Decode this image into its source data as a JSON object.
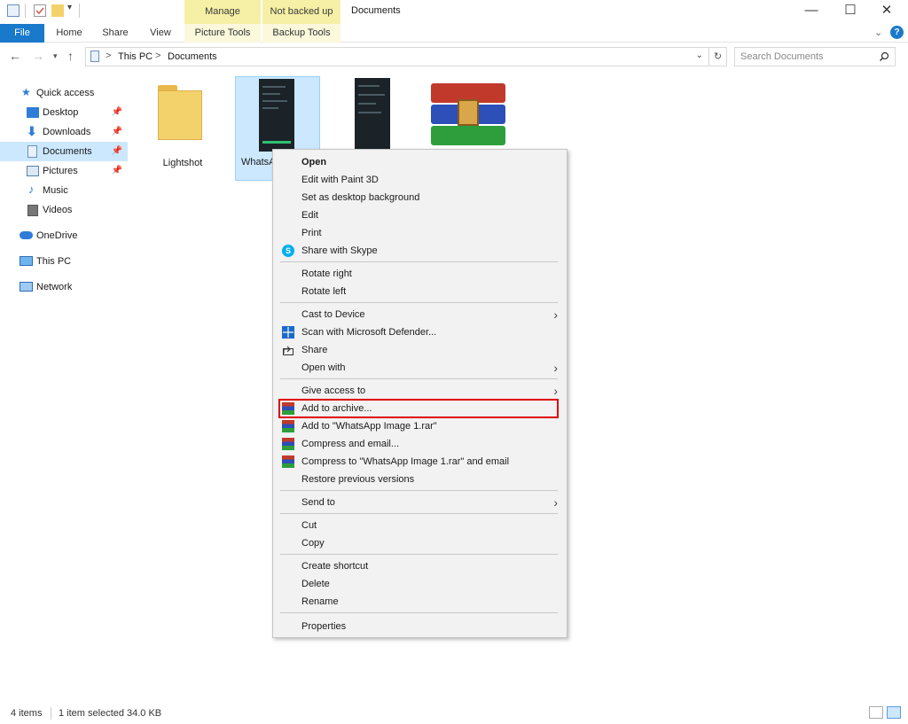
{
  "window": {
    "title": "Documents",
    "context_tab_manage": "Manage",
    "context_tab_backup": "Not backed up",
    "minimize": "—",
    "maximize": "☐",
    "close": "✕"
  },
  "ribbon": {
    "tabs": [
      "File",
      "Home",
      "Share",
      "View",
      "Picture Tools",
      "Backup Tools"
    ],
    "help": "?"
  },
  "address": {
    "crumbs": [
      "This PC",
      "Documents"
    ],
    "separator": ">",
    "search_placeholder": "Search Documents"
  },
  "sidebar": {
    "quick_access": "Quick access",
    "items": [
      {
        "label": "Desktop",
        "icon": "desktop-icon"
      },
      {
        "label": "Downloads",
        "icon": "download-icon"
      },
      {
        "label": "Documents",
        "icon": "document-icon"
      },
      {
        "label": "Pictures",
        "icon": "picture-icon"
      },
      {
        "label": "Music",
        "icon": "music-icon"
      },
      {
        "label": "Videos",
        "icon": "video-icon"
      }
    ],
    "onedrive": "OneDrive",
    "thispc": "This PC",
    "network": "Network"
  },
  "files": [
    {
      "name": "Lightshot",
      "icon": "folder-icon"
    },
    {
      "name": "WhatsA",
      "icon": "image-thumbnail-icon"
    },
    {
      "name": "",
      "icon": "image-thumbnail-icon"
    },
    {
      "name": "",
      "icon": "winrar-icon"
    }
  ],
  "context_menu": {
    "items": [
      "Open",
      "Edit with Paint 3D",
      "Set as desktop background",
      "Edit",
      "Print",
      "Share with Skype",
      "Rotate right",
      "Rotate left",
      "Cast to Device",
      "Scan with Microsoft Defender...",
      "Share",
      "Open with",
      "Give access to",
      "Add to archive...",
      "Add to \"WhatsApp Image 1.rar\"",
      "Compress and email...",
      "Compress to \"WhatsApp Image 1.rar\" and email",
      "Restore previous versions",
      "Send to",
      "Cut",
      "Copy",
      "Create shortcut",
      "Delete",
      "Rename",
      "Properties"
    ]
  },
  "status": {
    "item_count": "4 items",
    "selection": "1 item selected",
    "size": "34.0 KB"
  },
  "colors": {
    "accent": "#1979ca",
    "context_tab": "#f6f0a6",
    "selection": "#cce8ff",
    "highlight_border": "#e00000"
  }
}
